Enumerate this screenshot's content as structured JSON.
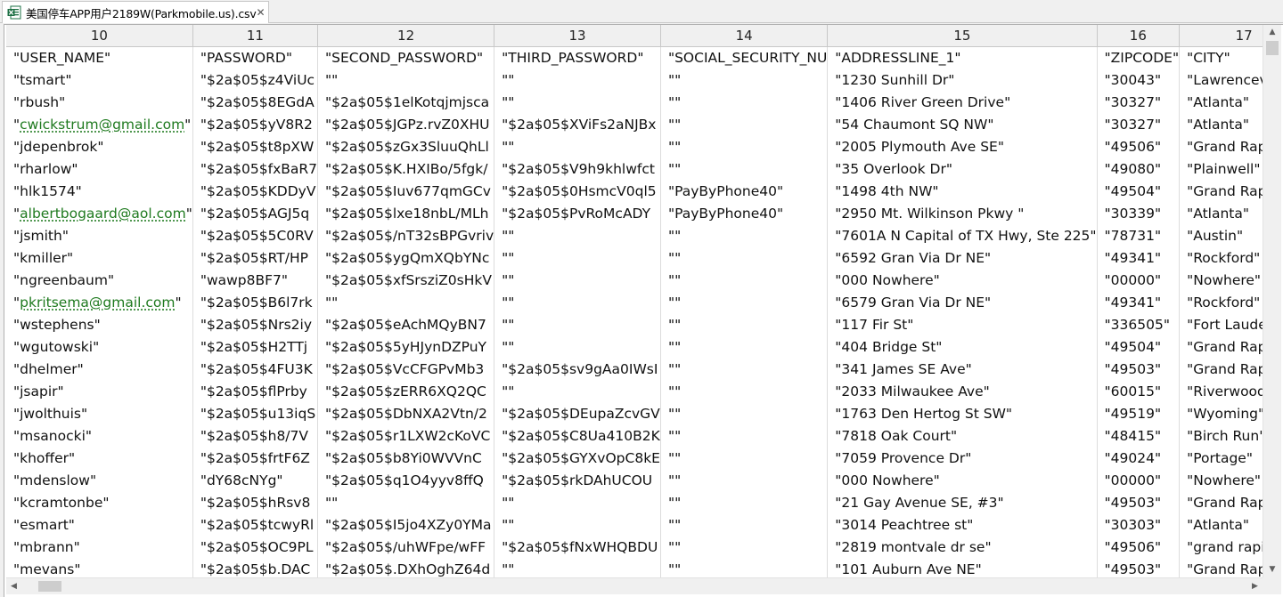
{
  "tab": {
    "title": "美国停车APP用户2189W(Parkmobile.us).csv",
    "icon": "excel-csv-file-icon",
    "close": "✕"
  },
  "grid": {
    "columns": [
      "10",
      "11",
      "12",
      "13",
      "14",
      "15",
      "16",
      "17"
    ],
    "rows": [
      [
        "\"USER_NAME\"",
        "\"PASSWORD\"",
        "\"SECOND_PASSWORD\"",
        "\"THIRD_PASSWORD\"",
        "\"SOCIAL_SECURITY_NU",
        "\"ADDRESSLINE_1\"",
        "\"ZIPCODE\"",
        "\"CITY\""
      ],
      [
        "\"tsmart\"",
        "\"$2a$05$z4ViUc",
        "\"\"",
        "\"\"",
        "\"\"",
        "\"1230 Sunhill Dr\"",
        "\"30043\"",
        "\"Lawrenceville\""
      ],
      [
        "\"rbush\"",
        "\"$2a$05$8EGdA",
        "\"$2a$05$1elKotqjmjsca",
        "\"\"",
        "\"\"",
        "\"1406 River Green Drive\"",
        "\"30327\"",
        "\"Atlanta\""
      ],
      [
        "\"cwickstrum@gmail.com\"",
        "\"$2a$05$yV8R2",
        "\"$2a$05$JGPz.rvZ0XHU",
        "\"$2a$05$XViFs2aNJBx",
        "\"\"",
        "\"54 Chaumont SQ NW\"",
        "\"30327\"",
        "\"Atlanta\""
      ],
      [
        "\"jdepenbrok\"",
        "\"$2a$05$t8pXW",
        "\"$2a$05$zGx3SluuQhLl",
        "\"\"",
        "\"\"",
        "\"2005 Plymouth Ave SE\"",
        "\"49506\"",
        "\"Grand Rapids\""
      ],
      [
        "\"rharlow\"",
        "\"$2a$05$fxBaR7",
        "\"$2a$05$K.HXIBo/5fgk/",
        "\"$2a$05$V9h9khlwfct",
        "\"\"",
        "\"35 Overlook Dr\"",
        "\"49080\"",
        "\"Plainwell\""
      ],
      [
        "\"hlk1574\"",
        "\"$2a$05$KDDyV",
        "\"$2a$05$Iuv677qmGCv",
        "\"$2a$05$0HsmcV0ql5",
        "\"PayByPhone40\"",
        "\"1498 4th NW\"",
        "\"49504\"",
        "\"Grand Rapids\""
      ],
      [
        "\"albertbogaard@aol.com\"",
        "\"$2a$05$AGJ5q",
        "\"$2a$05$lxe18nbL/MLh",
        "\"$2a$05$PvRoMcADY",
        "\"PayByPhone40\"",
        "\"2950 Mt. Wilkinson Pkwy \"",
        "\"30339\"",
        "\"Atlanta\""
      ],
      [
        "\"jsmith\"",
        "\"$2a$05$5C0RV",
        "\"$2a$05$/nT32sBPGvriv",
        "\"\"",
        "\"\"",
        "\"7601A N Capital of TX Hwy, Ste 225\"",
        "\"78731\"",
        "\"Austin\""
      ],
      [
        "\"kmiller\"",
        "\"$2a$05$RT/HP",
        "\"$2a$05$ygQmXQbYNc",
        "\"\"",
        "\"\"",
        "\"6592 Gran Via Dr NE\"",
        "\"49341\"",
        "\"Rockford\""
      ],
      [
        "\"ngreenbaum\"",
        "\"wawp8BF7\"",
        "\"$2a$05$xfSrsziZ0sHkV",
        "\"\"",
        "\"\"",
        "\"000 Nowhere\"",
        "\"00000\"",
        "\"Nowhere\""
      ],
      [
        "\"pkritsema@gmail.com\"",
        "\"$2a$05$B6l7rk",
        "\"\"",
        "\"\"",
        "\"\"",
        "\"6579 Gran Via Dr NE\"",
        "\"49341\"",
        "\"Rockford\""
      ],
      [
        "\"wstephens\"",
        "\"$2a$05$Nrs2iy",
        "\"$2a$05$eAchMQyBN7",
        "\"\"",
        "\"\"",
        "\"117 Fir St\"",
        "\"336505\"",
        "\"Fort Lauderdale\""
      ],
      [
        "\"wgutowski\"",
        "\"$2a$05$H2TTj",
        "\"$2a$05$5yHJynDZPuY",
        "\"\"",
        "\"\"",
        "\"404 Bridge St\"",
        "\"49504\"",
        "\"Grand Rapids\""
      ],
      [
        "\"dhelmer\"",
        "\"$2a$05$4FU3K",
        "\"$2a$05$VcCFGPvMb3",
        "\"$2a$05$sv9gAa0IWsI",
        "\"\"",
        "\"341 James SE Ave\"",
        "\"49503\"",
        "\"Grand Rapids\""
      ],
      [
        "\"jsapir\"",
        "\"$2a$05$flPrby",
        "\"$2a$05$zERR6XQ2QC",
        "\"\"",
        "\"\"",
        "\"2033 Milwaukee Ave\"",
        "\"60015\"",
        "\"Riverwoods\""
      ],
      [
        "\"jwolthuis\"",
        "\"$2a$05$u13iqS",
        "\"$2a$05$DbNXA2Vtn/2",
        "\"$2a$05$DEupaZcvGV",
        "\"\"",
        "\"1763 Den Hertog St SW\"",
        "\"49519\"",
        "\"Wyoming\""
      ],
      [
        "\"msanocki\"",
        "\"$2a$05$h8/7V",
        "\"$2a$05$r1LXW2cKoVC",
        "\"$2a$05$C8Ua410B2K",
        "\"\"",
        "\"7818 Oak Court\"",
        "\"48415\"",
        "\"Birch Run\""
      ],
      [
        "\"khoffer\"",
        "\"$2a$05$frtF6Z",
        "\"$2a$05$b8Yi0WVVnC",
        "\"$2a$05$GYXvOpC8kE",
        "\"\"",
        "\"7059 Provence Dr\"",
        "\"49024\"",
        "\"Portage\""
      ],
      [
        "\"mdenslow\"",
        "\"dY68cNYg\"",
        "\"$2a$05$q1O4yyv8ffQ",
        "\"$2a$05$rkDAhUCOU",
        "\"\"",
        "\"000 Nowhere\"",
        "\"00000\"",
        "\"Nowhere\""
      ],
      [
        "\"kcramtonbe\"",
        "\"$2a$05$hRsv8",
        "\"\"",
        "\"\"",
        "\"\"",
        "\"21 Gay Avenue SE, #3\"",
        "\"49503\"",
        "\"Grand Rapids\""
      ],
      [
        "\"esmart\"",
        "\"$2a$05$tcwyRl",
        "\"$2a$05$I5jo4XZy0YMa",
        "\"\"",
        "\"\"",
        "\"3014 Peachtree st\"",
        "\"30303\"",
        "\"Atlanta\""
      ],
      [
        "\"mbrann\"",
        "\"$2a$05$OC9PL",
        "\"$2a$05$/uhWFpe/wFF",
        "\"$2a$05$fNxWHQBDU",
        "\"\"",
        "\"2819 montvale dr se\"",
        "\"49506\"",
        "\"grand rapids\""
      ],
      [
        "\"mevans\"",
        "\"$2a$05$b.DAC",
        "\"$2a$05$.DXhOghZ64d",
        "\"\"",
        "\"\"",
        "\"101 Auburn Ave NE\"",
        "\"49503\"",
        "\"Grand Rapids\""
      ]
    ]
  },
  "scrollbars": {
    "up": "▲",
    "down": "▼",
    "left": "◀",
    "right": "▶"
  },
  "colors": {
    "email_text": "#1f7a1f",
    "excel_icon_green": "#1d7044"
  }
}
